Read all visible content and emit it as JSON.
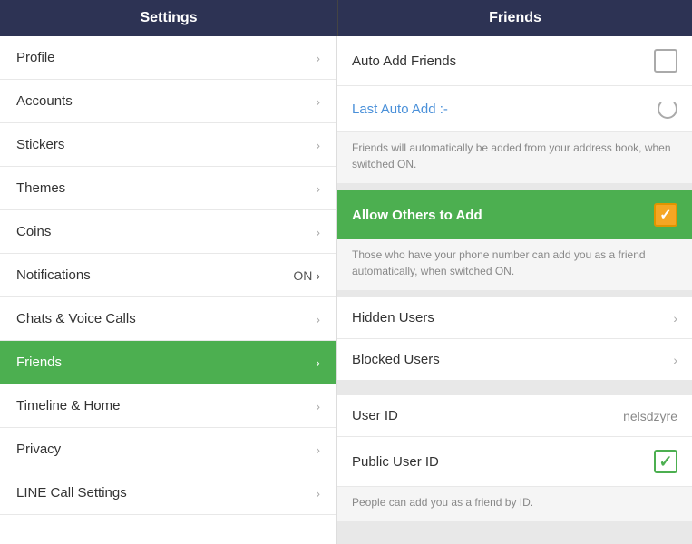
{
  "header": {
    "left_title": "Settings",
    "right_title": "Friends"
  },
  "left_menu": {
    "items": [
      {
        "id": "profile",
        "label": "Profile",
        "active": false
      },
      {
        "id": "accounts",
        "label": "Accounts",
        "active": false
      },
      {
        "id": "stickers",
        "label": "Stickers",
        "active": false
      },
      {
        "id": "themes",
        "label": "Themes",
        "active": false
      },
      {
        "id": "coins",
        "label": "Coins",
        "active": false
      },
      {
        "id": "notifications",
        "label": "Notifications",
        "badge": "ON",
        "active": false
      },
      {
        "id": "chats",
        "label": "Chats & Voice Calls",
        "active": false
      },
      {
        "id": "friends",
        "label": "Friends",
        "active": true
      },
      {
        "id": "timeline",
        "label": "Timeline & Home",
        "active": false
      },
      {
        "id": "privacy",
        "label": "Privacy",
        "active": false
      },
      {
        "id": "line-call",
        "label": "LINE Call Settings",
        "active": false
      }
    ]
  },
  "right_panel": {
    "auto_add_label": "Auto Add Friends",
    "last_auto_add_label": "Last Auto Add :-",
    "auto_add_description": "Friends will automatically be added from your address book, when switched ON.",
    "allow_others_label": "Allow Others to Add",
    "allow_others_description": "Those who have your phone number can add you as a friend automatically, when switched ON.",
    "hidden_users_label": "Hidden Users",
    "blocked_users_label": "Blocked Users",
    "user_id_label": "User ID",
    "user_id_value": "nelsdzyre",
    "public_user_id_label": "Public User ID",
    "public_user_id_description": "People can add you as a friend by ID."
  }
}
